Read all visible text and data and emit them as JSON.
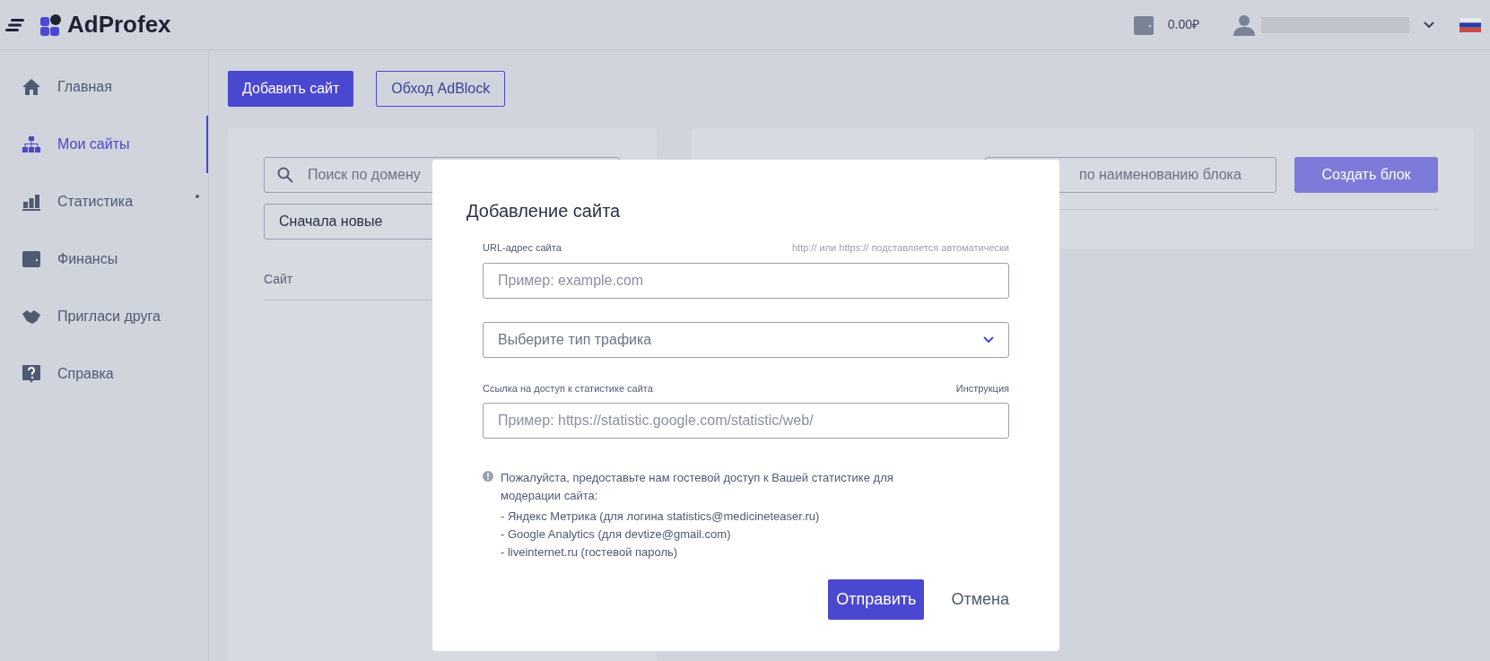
{
  "header": {
    "logo": "AdProfex",
    "balance": "0.00₽"
  },
  "sidebar": {
    "items": [
      {
        "label": "Главная",
        "selected": false,
        "dot": false
      },
      {
        "label": "Мои сайты",
        "selected": true,
        "dot": false
      },
      {
        "label": "Статистика",
        "selected": false,
        "dot": true
      },
      {
        "label": "Финансы",
        "selected": false,
        "dot": false
      },
      {
        "label": "Пригласи друга",
        "selected": false,
        "dot": false
      },
      {
        "label": "Справка",
        "selected": false,
        "dot": false
      }
    ]
  },
  "toolbar": [
    {
      "label": "Добавить сайт",
      "kind": "primary"
    },
    {
      "label": "Обход AdBlock",
      "kind": "outline"
    }
  ],
  "sites_panel": {
    "search": {
      "placeholder": "Поиск по домену"
    },
    "sort": {
      "value": "Сначала новые"
    },
    "columns": [
      "Сайт"
    ]
  },
  "blocks_panel": {
    "search": {
      "placeholder": "по наименованию блока"
    },
    "create_button": "Создать блок"
  },
  "modal": {
    "title": "Добавление сайта",
    "url_field": {
      "label": "URL-адрес сайта",
      "hint": "http:// или https:// подставляется автоматически",
      "placeholder": "Пример: example.com"
    },
    "traffic_select": {
      "placeholder": "Выберите тип трафика"
    },
    "stats_field": {
      "label": "Ссылка на доступ к статистике сайта",
      "link": "Инструкция",
      "placeholder": "Пример: https://statistic.google.com/statistic/web/"
    },
    "notice": "Пожалуйста, предоставьте нам гостевой доступ к Вашей статистике для модерации сайта:",
    "notice_items": [
      "- Яндекс Метрика (для логина statistics@medicineteaser.ru)",
      "- Google Analytics (для devtize@gmail.com)",
      "- liveinternet.ru (гостевой пароль)"
    ],
    "submit": "Отправить",
    "cancel": "Отмена"
  }
}
